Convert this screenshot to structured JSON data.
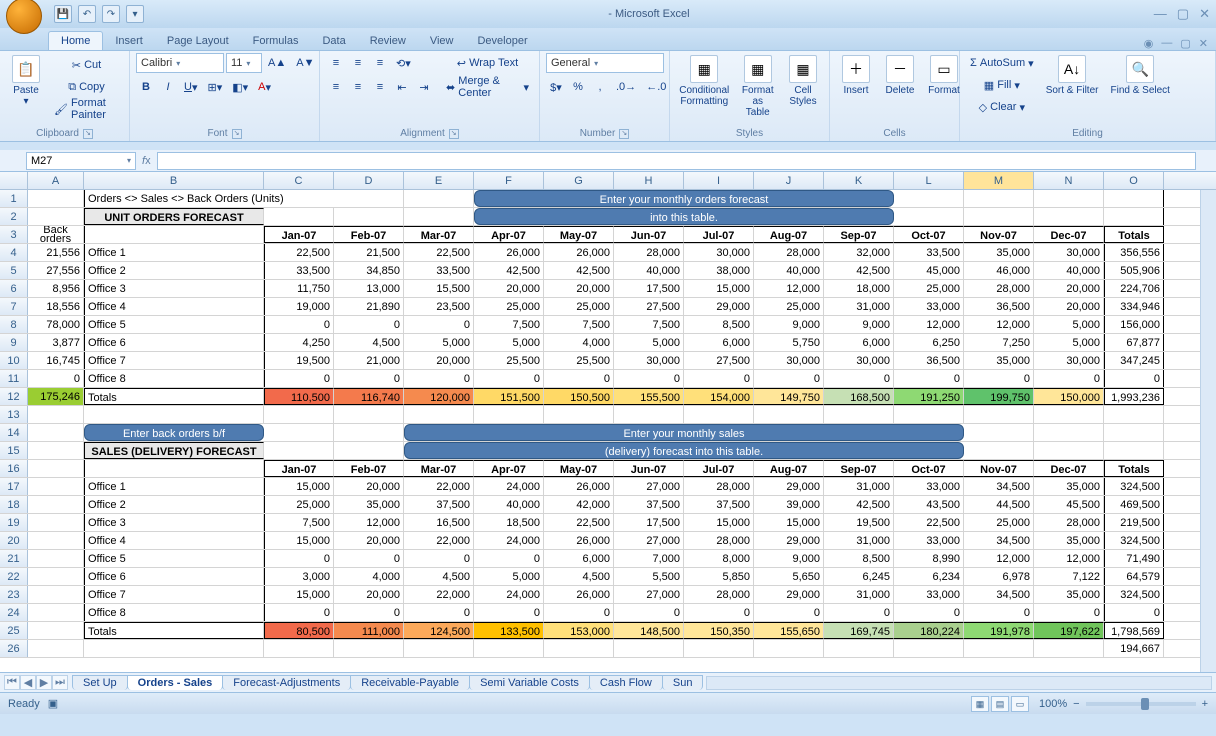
{
  "app": {
    "title": "Microsoft Excel"
  },
  "qat": {
    "save": "💾",
    "undo": "↶",
    "redo": "↷"
  },
  "tabs": [
    "Home",
    "Insert",
    "Page Layout",
    "Formulas",
    "Data",
    "Review",
    "View",
    "Developer"
  ],
  "ribbon": {
    "clipboard": {
      "paste": "Paste",
      "cut": "Cut",
      "copy": "Copy",
      "painter": "Format Painter",
      "title": "Clipboard"
    },
    "font": {
      "name": "Calibri",
      "size": "11",
      "title": "Font"
    },
    "align": {
      "wrap": "Wrap Text",
      "merge": "Merge & Center",
      "title": "Alignment"
    },
    "number": {
      "format": "General",
      "title": "Number"
    },
    "styles": {
      "cond": "Conditional Formatting",
      "table": "Format as Table",
      "cell": "Cell Styles",
      "title": "Styles"
    },
    "cells": {
      "insert": "Insert",
      "delete": "Delete",
      "format": "Format",
      "title": "Cells"
    },
    "editing": {
      "sum": "AutoSum",
      "fill": "Fill",
      "clear": "Clear",
      "sort": "Sort & Filter",
      "find": "Find & Select",
      "title": "Editing"
    }
  },
  "namebox": "M27",
  "cols": [
    "A",
    "B",
    "C",
    "D",
    "E",
    "F",
    "G",
    "H",
    "I",
    "J",
    "K",
    "L",
    "M",
    "N",
    "O"
  ],
  "widths": [
    56,
    180,
    70,
    70,
    70,
    70,
    70,
    70,
    70,
    70,
    70,
    70,
    70,
    70,
    60
  ],
  "activeCol": 12,
  "sheet": {
    "r1": {
      "b": "Orders <> Sales <> Back Orders (Units)",
      "callout": "Enter your monthly orders forecast"
    },
    "r2": {
      "hdr": "UNIT ORDERS FORECAST",
      "callout": "into this table."
    },
    "r3": {
      "a1": "Back",
      "a2": "orders",
      "months": [
        "Jan-07",
        "Feb-07",
        "Mar-07",
        "Apr-07",
        "May-07",
        "Jun-07",
        "Jul-07",
        "Aug-07",
        "Sep-07",
        "Oct-07",
        "Nov-07",
        "Dec-07"
      ],
      "totals": "Totals"
    },
    "orders": [
      {
        "bo": "21,556",
        "name": "Office 1",
        "v": [
          "22,500",
          "21,500",
          "22,500",
          "26,000",
          "26,000",
          "28,000",
          "30,000",
          "28,000",
          "32,000",
          "33,500",
          "35,000",
          "30,000"
        ],
        "t": "356,556"
      },
      {
        "bo": "27,556",
        "name": "Office 2",
        "v": [
          "33,500",
          "34,850",
          "33,500",
          "42,500",
          "42,500",
          "40,000",
          "38,000",
          "40,000",
          "42,500",
          "45,000",
          "46,000",
          "40,000"
        ],
        "t": "505,906"
      },
      {
        "bo": "8,956",
        "name": "Office 3",
        "v": [
          "11,750",
          "13,000",
          "15,500",
          "20,000",
          "20,000",
          "17,500",
          "15,000",
          "12,000",
          "18,000",
          "25,000",
          "28,000",
          "20,000"
        ],
        "t": "224,706"
      },
      {
        "bo": "18,556",
        "name": "Office 4",
        "v": [
          "19,000",
          "21,890",
          "23,500",
          "25,000",
          "25,000",
          "27,500",
          "29,000",
          "25,000",
          "31,000",
          "33,000",
          "36,500",
          "20,000"
        ],
        "t": "334,946"
      },
      {
        "bo": "78,000",
        "name": "Office 5",
        "v": [
          "0",
          "0",
          "0",
          "7,500",
          "7,500",
          "7,500",
          "8,500",
          "9,000",
          "9,000",
          "12,000",
          "12,000",
          "5,000"
        ],
        "t": "156,000"
      },
      {
        "bo": "3,877",
        "name": "Office 6",
        "v": [
          "4,250",
          "4,500",
          "5,000",
          "5,000",
          "4,000",
          "5,000",
          "6,000",
          "5,750",
          "6,000",
          "6,250",
          "7,250",
          "5,000"
        ],
        "t": "67,877"
      },
      {
        "bo": "16,745",
        "name": "Office 7",
        "v": [
          "19,500",
          "21,000",
          "20,000",
          "25,500",
          "25,500",
          "30,000",
          "27,500",
          "30,000",
          "30,000",
          "36,500",
          "35,000",
          "30,000"
        ],
        "t": "347,245"
      },
      {
        "bo": "0",
        "name": "Office 8",
        "v": [
          "0",
          "0",
          "0",
          "0",
          "0",
          "0",
          "0",
          "0",
          "0",
          "0",
          "0",
          "0"
        ],
        "t": "0"
      }
    ],
    "ordersTotal": {
      "bo": "175,246",
      "name": "Totals",
      "v": [
        "110,500",
        "116,740",
        "120,000",
        "151,500",
        "150,500",
        "155,500",
        "154,000",
        "149,750",
        "168,500",
        "191,250",
        "199,750",
        "150,000"
      ],
      "t": "1,993,236"
    },
    "ordersTotalColors": [
      "#f26a4b",
      "#f47a4c",
      "#f58a4e",
      "#ffd966",
      "#ffd966",
      "#ffe07a",
      "#ffe07a",
      "#ffe699",
      "#c6e0b4",
      "#8ed973",
      "#5fc26b",
      "#ffe699"
    ],
    "r14": {
      "btn": "Enter back orders b/f",
      "callout1": "Enter your monthly sales"
    },
    "r15": {
      "hdr": "SALES (DELIVERY) FORECAST",
      "callout2": "(delivery) forecast into this table."
    },
    "sales": [
      {
        "name": "Office 1",
        "v": [
          "15,000",
          "20,000",
          "22,000",
          "24,000",
          "26,000",
          "27,000",
          "28,000",
          "29,000",
          "31,000",
          "33,000",
          "34,500",
          "35,000"
        ],
        "t": "324,500"
      },
      {
        "name": "Office 2",
        "v": [
          "25,000",
          "35,000",
          "37,500",
          "40,000",
          "42,000",
          "37,500",
          "37,500",
          "39,000",
          "42,500",
          "43,500",
          "44,500",
          "45,500"
        ],
        "t": "469,500"
      },
      {
        "name": "Office 3",
        "v": [
          "7,500",
          "12,000",
          "16,500",
          "18,500",
          "22,500",
          "17,500",
          "15,000",
          "15,000",
          "19,500",
          "22,500",
          "25,000",
          "28,000"
        ],
        "t": "219,500"
      },
      {
        "name": "Office 4",
        "v": [
          "15,000",
          "20,000",
          "22,000",
          "24,000",
          "26,000",
          "27,000",
          "28,000",
          "29,000",
          "31,000",
          "33,000",
          "34,500",
          "35,000"
        ],
        "t": "324,500"
      },
      {
        "name": "Office 5",
        "v": [
          "0",
          "0",
          "0",
          "0",
          "6,000",
          "7,000",
          "8,000",
          "9,000",
          "8,500",
          "8,990",
          "12,000",
          "12,000"
        ],
        "t": "71,490"
      },
      {
        "name": "Office 6",
        "v": [
          "3,000",
          "4,000",
          "4,500",
          "5,000",
          "4,500",
          "5,500",
          "5,850",
          "5,650",
          "6,245",
          "6,234",
          "6,978",
          "7,122"
        ],
        "t": "64,579"
      },
      {
        "name": "Office 7",
        "v": [
          "15,000",
          "20,000",
          "22,000",
          "24,000",
          "26,000",
          "27,000",
          "28,000",
          "29,000",
          "31,000",
          "33,000",
          "34,500",
          "35,000"
        ],
        "t": "324,500"
      },
      {
        "name": "Office 8",
        "v": [
          "0",
          "0",
          "0",
          "0",
          "0",
          "0",
          "0",
          "0",
          "0",
          "0",
          "0",
          "0"
        ],
        "t": "0"
      }
    ],
    "salesTotal": {
      "name": "Totals",
      "v": [
        "80,500",
        "111,000",
        "124,500",
        "133,500",
        "153,000",
        "148,500",
        "150,350",
        "155,650",
        "169,745",
        "180,224",
        "191,978",
        "197,622"
      ],
      "t": "1,798,569"
    },
    "salesTotalColors": [
      "#f26a4b",
      "#f58a4e",
      "#fca95a",
      "#ffc000",
      "#ffe07a",
      "#ffe699",
      "#ffe699",
      "#ffe699",
      "#c6e0b4",
      "#a9d08e",
      "#8ed973",
      "#70c55b"
    ],
    "r26": "194,667"
  },
  "sheets": [
    "Set Up",
    "Orders - Sales",
    "Forecast-Adjustments",
    "Receivable-Payable",
    "Semi Variable Costs",
    "Cash Flow",
    "Sun"
  ],
  "status": {
    "ready": "Ready",
    "zoom": "100%"
  }
}
